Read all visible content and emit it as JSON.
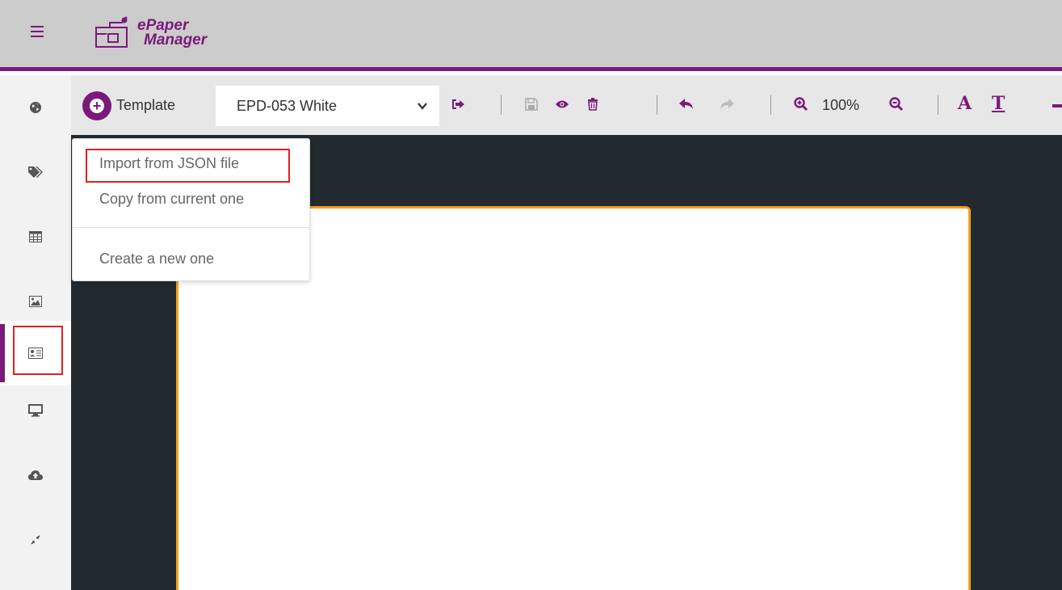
{
  "app": {
    "logo_line1": "ePaper",
    "logo_line2": "Manager"
  },
  "colors": {
    "accent": "#7a1a7a",
    "header_bg": "#cccccc",
    "canvas_bg": "#222a30",
    "paper_border": "#f0a018",
    "highlight": "#e02020"
  },
  "sidebar": {
    "items": [
      {
        "icon": "globe-icon"
      },
      {
        "icon": "tags-icon"
      },
      {
        "icon": "table-icon"
      },
      {
        "icon": "image-icon"
      },
      {
        "icon": "id-card-icon",
        "active": true
      },
      {
        "icon": "monitor-icon"
      },
      {
        "icon": "cloud-upload-icon"
      },
      {
        "icon": "compress-icon"
      }
    ]
  },
  "toolbar": {
    "template_label": "Template",
    "template_select": {
      "value": "EPD-053 White"
    },
    "zoom": "100%",
    "font_label": "A",
    "text_label": "T"
  },
  "menu": {
    "items": [
      {
        "label": "Import from JSON file"
      },
      {
        "label": "Copy from current one"
      },
      {
        "label": "Create a new one"
      }
    ]
  }
}
